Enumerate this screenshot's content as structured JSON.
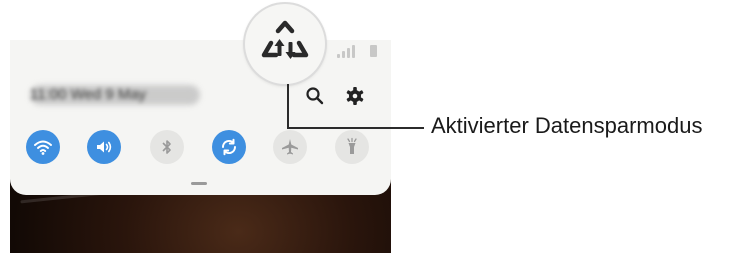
{
  "panel": {
    "datetime": "11:00 Wed 9 May",
    "quick_toggles": [
      {
        "name": "wifi",
        "icon": "wifi-icon",
        "state": "on"
      },
      {
        "name": "sound",
        "icon": "sound-icon",
        "state": "on"
      },
      {
        "name": "bluetooth",
        "icon": "bluetooth-icon",
        "state": "off"
      },
      {
        "name": "auto-rotate",
        "icon": "rotate-icon",
        "state": "on"
      },
      {
        "name": "airplane-mode",
        "icon": "airplane-icon",
        "state": "off"
      },
      {
        "name": "flashlight",
        "icon": "flashlight-icon",
        "state": "off"
      }
    ],
    "header_icons": [
      "search-icon",
      "gear-icon"
    ]
  },
  "highlight": {
    "icon": "data-saver-icon",
    "label": "Aktivierter Datensparmodus"
  },
  "colors": {
    "accent": "#3e8fe0",
    "panel_bg": "#f5f5f3",
    "toggle_off": "#e5e5e3"
  }
}
